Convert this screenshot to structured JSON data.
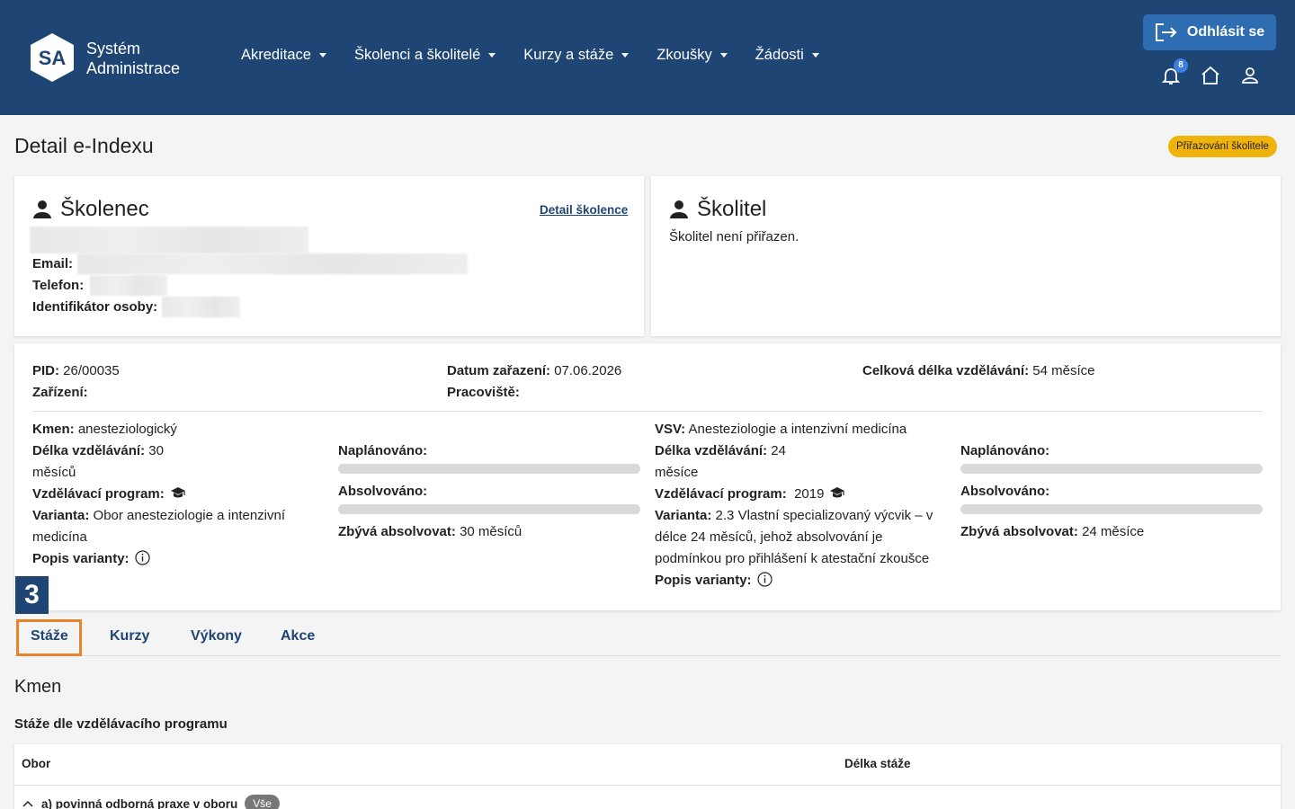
{
  "header": {
    "logo_mark": "SA",
    "logo_line1": "Systém",
    "logo_line2": "Administrace",
    "nav": [
      "Akreditace",
      "Školenci a školitelé",
      "Kurzy a stáže",
      "Zkoušky",
      "Žádosti"
    ],
    "logout_label": "Odhlásit se",
    "notification_count": "8"
  },
  "page": {
    "title": "Detail e-Indexu",
    "status_badge": "Přiřazování školitele"
  },
  "trainee": {
    "heading": "Školenec",
    "detail_link": "Detail školence",
    "email_label": "Email:",
    "phone_label": "Telefon:",
    "id_label": "Identifikátor osoby:"
  },
  "supervisor": {
    "heading": "Školitel",
    "text": "Školitel není přiřazen."
  },
  "summary": {
    "pid_label": "PID:",
    "pid_value": "26/00035",
    "facility_label": "Zařízení:",
    "date_label": "Datum zařazení:",
    "date_value": "07.06.2026",
    "workplace_label": "Pracoviště:",
    "total_label": "Celková délka vzdělávání:",
    "total_value": "54 měsíce"
  },
  "kmen": {
    "name_label": "Kmen:",
    "name_value": "anesteziologický",
    "length_label": "Délka vzdělávání:",
    "length_value": "30",
    "length_unit": "měsíců",
    "program_label": "Vzdělávací program:",
    "variant_label": "Varianta:",
    "variant_line1": "Obor anesteziologie a intenzivní",
    "variant_line2": "medicína",
    "variant_desc_label": "Popis varianty:",
    "planned_label": "Naplánováno:",
    "planned_fraction": 0,
    "completed_label": "Absolvováno:",
    "completed_fraction": 0,
    "remaining_label": "Zbývá absolvovat:",
    "remaining_value": "30 měsíců"
  },
  "vsv": {
    "name_label": "VSV:",
    "name_value": "Anesteziologie a intenzivní medicína",
    "length_label": "Délka vzdělávání:",
    "length_value": "24",
    "length_unit": "měsíce",
    "program_label": "Vzdělávací program:",
    "program_value": "2019",
    "variant_label": "Varianta:",
    "variant_line1": "2.3 Vlastní specializovaný výcvik – v",
    "variant_line2": "délce 24 měsíců, jehož absolvování je",
    "variant_line3": "podmínkou pro přihlášení k atestační zkoušce",
    "variant_desc_label": "Popis varianty:",
    "planned_label": "Naplánováno:",
    "planned_fraction": 0,
    "completed_label": "Absolvováno:",
    "completed_fraction": 0,
    "remaining_label": "Zbývá absolvovat:",
    "remaining_value": "24 měsíce"
  },
  "step_marker": "3",
  "tabs": [
    "Stáže",
    "Kurzy",
    "Výkony",
    "Akce"
  ],
  "section": {
    "heading": "Kmen",
    "subheading": "Stáže dle vzdělávacího programu"
  },
  "table": {
    "col_obor": "Obor",
    "col_length": "Délka stáže",
    "row1_label": "a) povinná odborná praxe v oboru",
    "row1_badge": "Vše"
  },
  "colors": {
    "header_bg": "#1e4573",
    "accent": "#2f6db3",
    "badge_yellow": "#f0b30c",
    "active_tab_border": "#e8832a"
  }
}
